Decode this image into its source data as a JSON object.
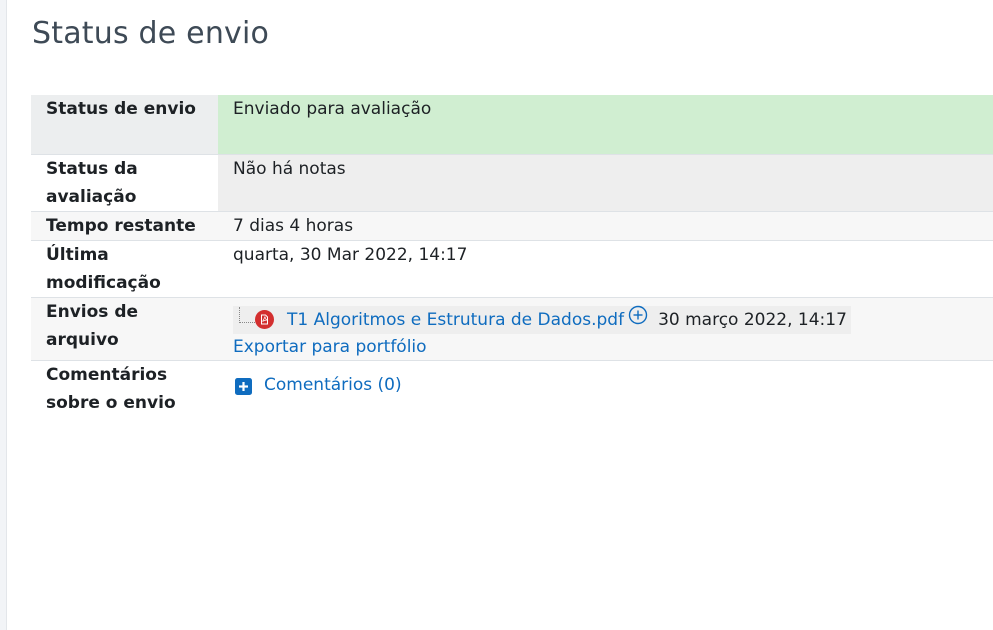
{
  "page_title": "Status de envio",
  "rows": {
    "submission_status": {
      "label": "Status de envio",
      "value": "Enviado para avaliação"
    },
    "grading_status": {
      "label_line1": "Status da",
      "label_line2": "avaliação",
      "value": "Não há notas"
    },
    "time_remaining": {
      "label": "Tempo restante",
      "value": "7 dias 4 horas"
    },
    "last_modified": {
      "label_line1": "Última",
      "label_line2": "modificação",
      "value": "quarta, 30 Mar 2022, 14:17"
    },
    "file_submissions": {
      "label_line1": "Envios de",
      "label_line2": "arquivo",
      "file_name": "T1 Algoritmos e Estrutura de Dados.pdf",
      "file_date": "30 março 2022, 14:17",
      "export_link": "Exportar para portfólio",
      "file_icon": "pdf-icon"
    },
    "submission_comments": {
      "label_line1": "Comentários",
      "label_line2": "sobre o envio",
      "link": "Comentários (0)",
      "icon": "plus-square-icon"
    }
  },
  "colors": {
    "link": "#0f6cbf",
    "submitted_bg": "#d0eed1",
    "pdf_red": "#d32f2f"
  }
}
